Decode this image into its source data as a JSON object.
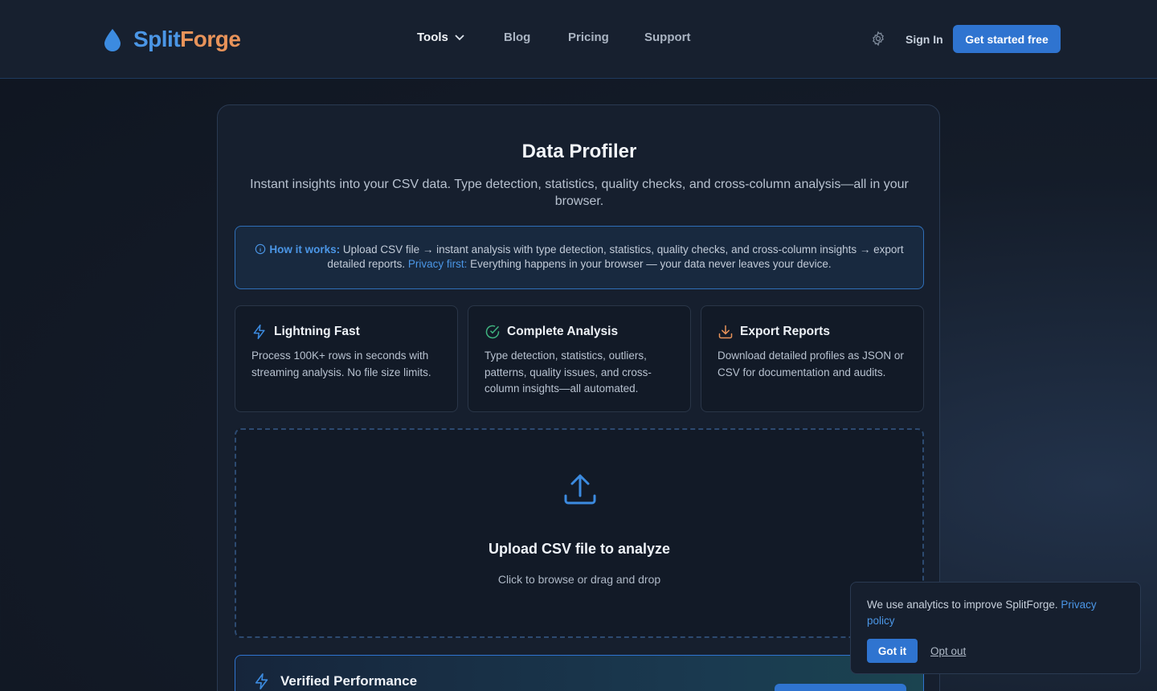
{
  "header": {
    "logo": {
      "part1": "Split",
      "part2": "Forge"
    },
    "nav": [
      {
        "label": "Tools"
      },
      {
        "label": "Blog"
      },
      {
        "label": "Pricing"
      },
      {
        "label": "Support"
      }
    ],
    "sign_in": "Sign In",
    "cta": "Get started free"
  },
  "main": {
    "title": "Data Profiler",
    "subtitle": "Instant insights into your CSV data. Type detection, statistics, quality checks, and cross-column analysis—all in your browser.",
    "how": {
      "label": "How it works:",
      "text1": " Upload CSV file → instant analysis with type detection, statistics, quality checks, and cross-column insights → export detailed reports. ",
      "privacy_label": "Privacy first:",
      "text2": " Everything happens in your browser — your data never leaves your device."
    },
    "features": [
      {
        "title": "Lightning Fast",
        "desc": "Process 100K+ rows in seconds with streaming analysis. No file size limits."
      },
      {
        "title": "Complete Analysis",
        "desc": "Type detection, statistics, outliers, patterns, quality issues, and cross-column insights—all automated."
      },
      {
        "title": "Export Reports",
        "desc": "Download detailed profiles as JSON or CSV for documentation and audits."
      }
    ],
    "upload": {
      "title": "Upload CSV file to analyze",
      "subtitle": "Click to browse or drag and drop"
    },
    "verified": {
      "title": "Verified Performance"
    }
  },
  "cookie": {
    "text": "We use analytics to improve SplitForge. ",
    "link": "Privacy policy",
    "accept": "Got it",
    "optout": "Opt out"
  },
  "colors": {
    "accent": "#2f74d0",
    "brand_blue": "#4b96e6",
    "brand_orange": "#e8935a",
    "success": "#3fb37f"
  }
}
